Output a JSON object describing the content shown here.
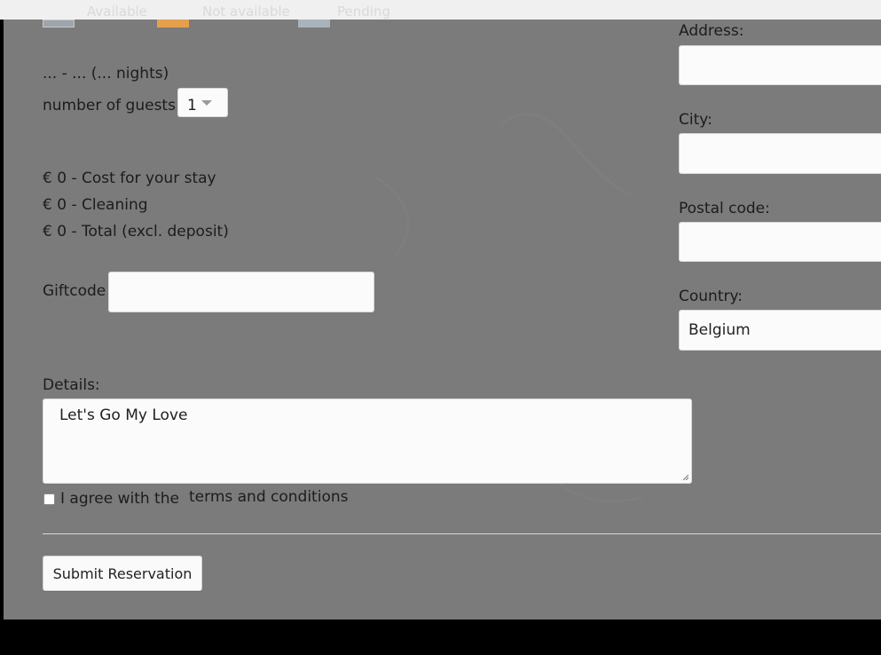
{
  "legend": {
    "available": "Available",
    "not_available": "Not available",
    "pending": "Pending",
    "available_color": "#9ea5ad",
    "not_available_color": "#e6a04d",
    "pending_color": "#aab3bd"
  },
  "stay": {
    "dates": "... - ... (... nights)",
    "guests_label": "number of guests:",
    "guests_value": "1"
  },
  "costs": {
    "stay": "€ 0 - Cost for your stay",
    "cleaning": "€ 0 - Cleaning",
    "total": "€ 0 - Total (excl. deposit)"
  },
  "giftcode": {
    "label": "Giftcode",
    "value": ""
  },
  "address": {
    "label": "Address:",
    "value": ""
  },
  "city": {
    "label": "City:",
    "value": ""
  },
  "postal": {
    "label": "Postal code:",
    "value": ""
  },
  "country": {
    "label": "Country:",
    "value": "Belgium"
  },
  "details": {
    "label": "Details:",
    "value": "Let's Go My Love"
  },
  "terms": {
    "prefix": "I agree with the",
    "link": "terms and conditions"
  },
  "submit_label": "Submit Reservation"
}
